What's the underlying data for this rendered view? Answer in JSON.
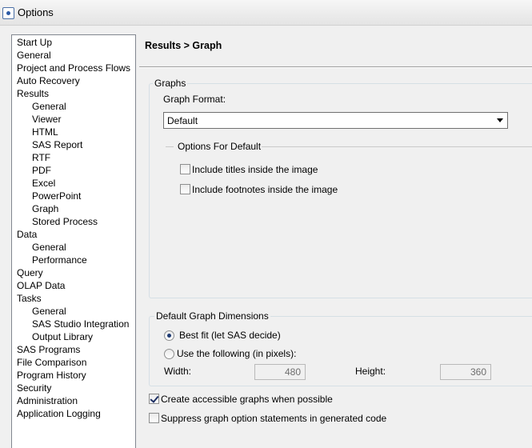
{
  "window": {
    "title": "Options"
  },
  "sidebar": {
    "items": [
      {
        "label": "Start Up",
        "level": 0
      },
      {
        "label": "General",
        "level": 0
      },
      {
        "label": "Project and Process Flows",
        "level": 0
      },
      {
        "label": "Auto Recovery",
        "level": 0
      },
      {
        "label": "Results",
        "level": 0
      },
      {
        "label": "General",
        "level": 1
      },
      {
        "label": "Viewer",
        "level": 1
      },
      {
        "label": "HTML",
        "level": 1
      },
      {
        "label": "SAS Report",
        "level": 1
      },
      {
        "label": "RTF",
        "level": 1
      },
      {
        "label": "PDF",
        "level": 1
      },
      {
        "label": "Excel",
        "level": 1
      },
      {
        "label": "PowerPoint",
        "level": 1
      },
      {
        "label": "Graph",
        "level": 1,
        "selected": true
      },
      {
        "label": "Stored Process",
        "level": 1
      },
      {
        "label": "Data",
        "level": 0
      },
      {
        "label": "General",
        "level": 1
      },
      {
        "label": "Performance",
        "level": 1
      },
      {
        "label": "Query",
        "level": 0
      },
      {
        "label": "OLAP Data",
        "level": 0
      },
      {
        "label": "Tasks",
        "level": 0
      },
      {
        "label": "General",
        "level": 1
      },
      {
        "label": "SAS Studio Integration",
        "level": 1
      },
      {
        "label": "Output Library",
        "level": 1
      },
      {
        "label": "SAS Programs",
        "level": 0
      },
      {
        "label": "File Comparison",
        "level": 0
      },
      {
        "label": "Program History",
        "level": 0
      },
      {
        "label": "Security",
        "level": 0
      },
      {
        "label": "Administration",
        "level": 0
      },
      {
        "label": "Application Logging",
        "level": 0
      }
    ]
  },
  "panel": {
    "title": "Results > Graph",
    "graphs_group": {
      "legend": "Graphs",
      "format_label": "Graph Format:",
      "format_value": "Default",
      "options_group": {
        "legend": "Options For Default",
        "include_titles": {
          "label": "Include titles inside the image",
          "checked": false
        },
        "include_footnotes": {
          "label": "Include footnotes inside the image",
          "checked": false
        }
      }
    },
    "dimensions_group": {
      "legend": "Default Graph Dimensions",
      "best_fit": {
        "label": "Best fit (let SAS decide)",
        "selected": true
      },
      "use_following": {
        "label": "Use the following (in pixels):",
        "selected": false
      },
      "width_label": "Width:",
      "width_value": "480",
      "height_label": "Height:",
      "height_value": "360"
    },
    "accessible": {
      "label": "Create accessible graphs when possible",
      "checked": true
    },
    "suppress": {
      "label": "Suppress graph option statements in generated code",
      "checked": false
    }
  }
}
